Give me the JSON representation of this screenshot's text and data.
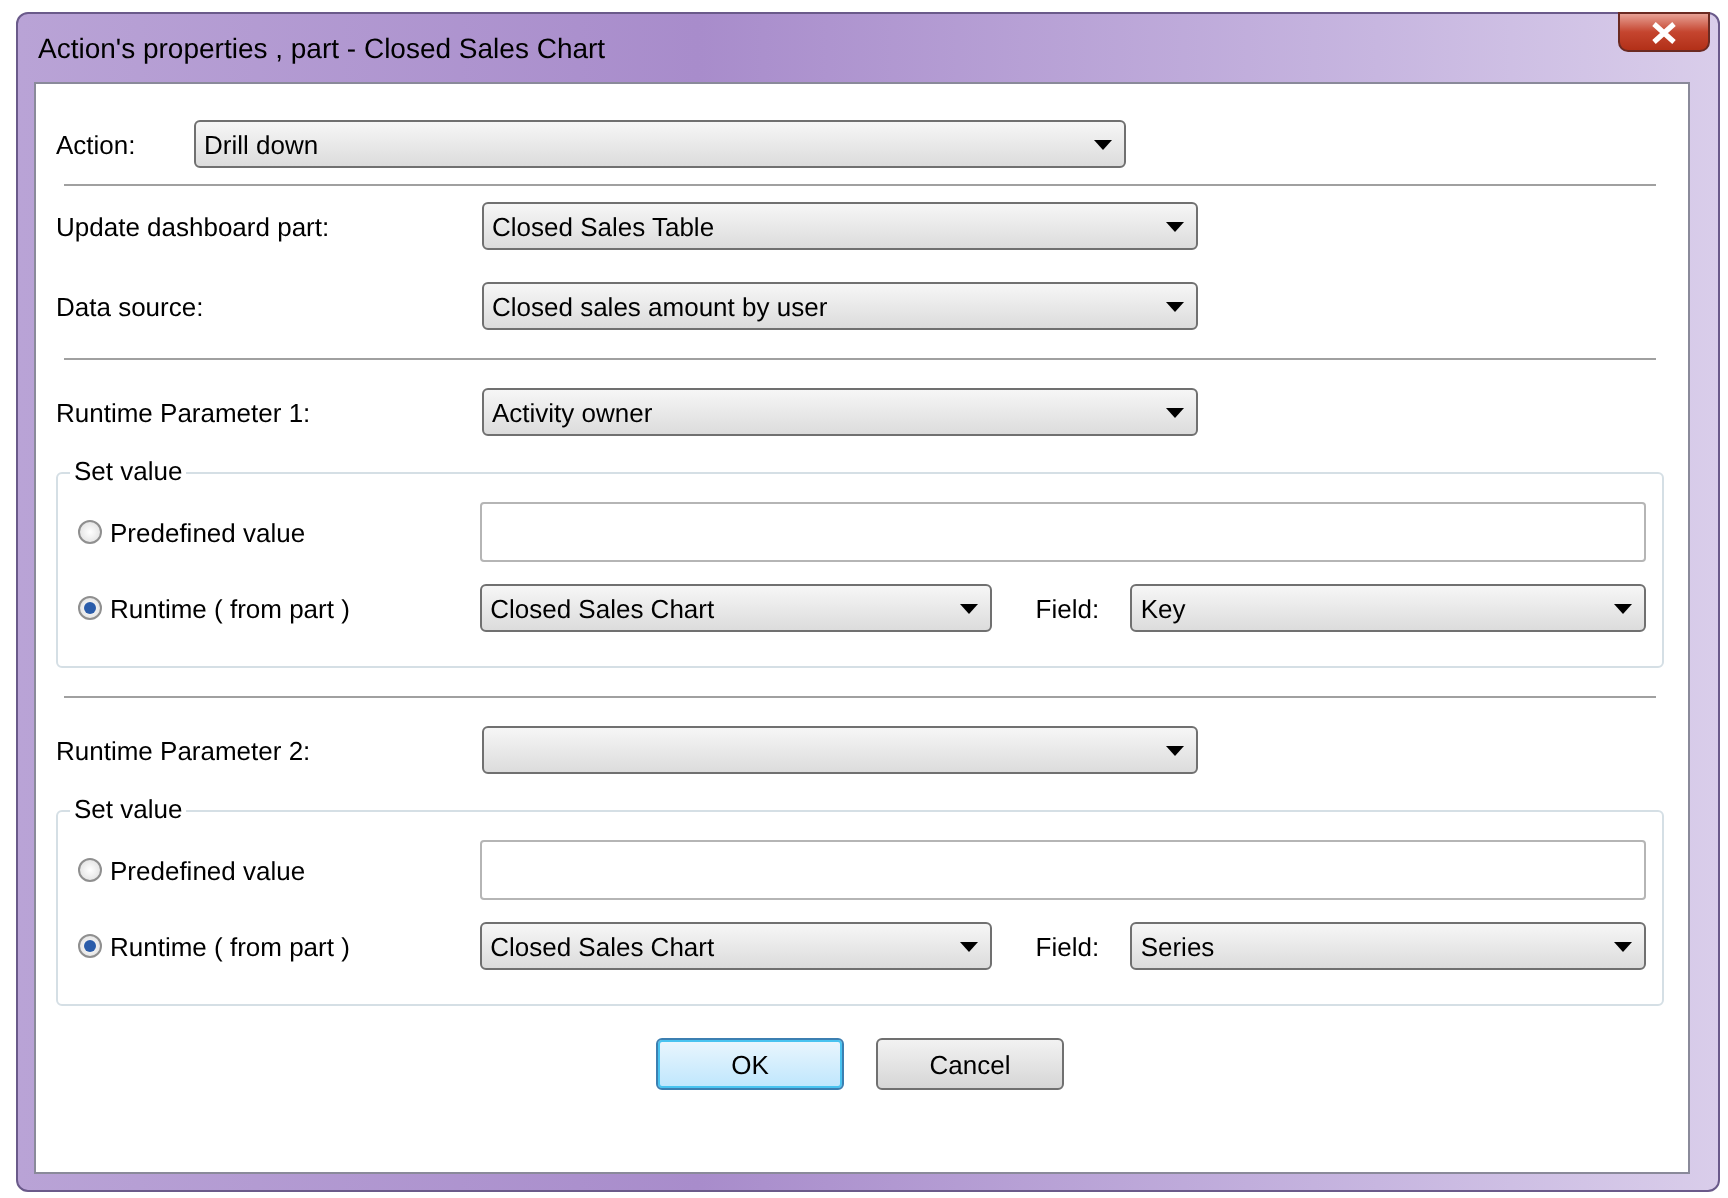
{
  "window": {
    "title": "Action's properties , part - Closed Sales Chart"
  },
  "action": {
    "label": "Action:",
    "value": "Drill down"
  },
  "fields": [
    {
      "label": "Update dashboard part:",
      "value": "Closed Sales Table"
    },
    {
      "label": "Data source:",
      "value": "Closed sales amount by user"
    }
  ],
  "parameters": [
    {
      "label": "Runtime Parameter 1:",
      "value": "Activity owner",
      "group_title": "Set value",
      "options": [
        {
          "label": "Predefined value",
          "selected": false
        },
        {
          "label": "Runtime ( from part )",
          "selected": true
        }
      ],
      "part": "Closed Sales Chart",
      "field_label": "Field:",
      "field": "Key"
    },
    {
      "label": "Runtime Parameter 2:",
      "group_title": "Set value",
      "options": [
        {
          "label": "Predefined value",
          "selected": false
        },
        {
          "label": "Runtime ( from part )",
          "selected": true
        }
      ],
      "part": "Closed Sales Chart",
      "field_label": "Field:",
      "field": "Series"
    }
  ],
  "buttons": [
    {
      "label": "OK",
      "default": true
    },
    {
      "label": "Cancel",
      "default": false
    }
  ]
}
